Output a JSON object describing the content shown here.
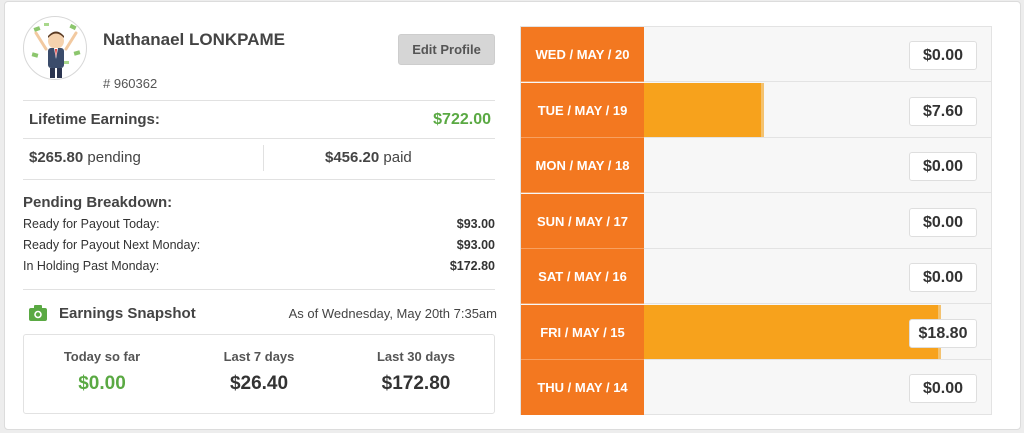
{
  "profile": {
    "name": "Nathanael LONKPAME",
    "id": "# 960362",
    "edit_label": "Edit Profile"
  },
  "lifetime": {
    "label": "Lifetime Earnings:",
    "value": "$722.00"
  },
  "split": {
    "pending_amount": "$265.80",
    "pending_word": "pending",
    "paid_amount": "$456.20",
    "paid_word": "paid"
  },
  "pending_breakdown": {
    "title": "Pending Breakdown:",
    "rows": [
      {
        "label": "Ready for Payout Today:",
        "value": "$93.00"
      },
      {
        "label": "Ready for Payout Next Monday:",
        "value": "$93.00"
      },
      {
        "label": "In Holding Past Monday:",
        "value": "$172.80"
      }
    ]
  },
  "snapshot": {
    "title": "Earnings Snapshot",
    "as_of": "As of Wednesday, May 20th 7:35am",
    "icon": "camera-icon",
    "stats": [
      {
        "label": "Today so far",
        "value": "$0.00"
      },
      {
        "label": "Last 7 days",
        "value": "$26.40"
      },
      {
        "label": "Last 30 days",
        "value": "$172.80"
      }
    ]
  },
  "colors": {
    "accent_orange": "#f37820",
    "bar_orange": "#f7a21c",
    "positive_green": "#5aa943"
  },
  "chart_data": {
    "type": "bar",
    "categories": [
      "WED / MAY / 20",
      "TUE / MAY / 19",
      "MON / MAY / 18",
      "SUN / MAY / 17",
      "SAT / MAY / 16",
      "FRI / MAY / 15",
      "THU / MAY / 14"
    ],
    "values": [
      0.0,
      7.6,
      0.0,
      0.0,
      0.0,
      18.8,
      0.0
    ],
    "value_labels": [
      "$0.00",
      "$7.60",
      "$0.00",
      "$0.00",
      "$0.00",
      "$18.80",
      "$0.00"
    ],
    "orientation": "horizontal",
    "xlim": [
      0,
      22
    ]
  }
}
